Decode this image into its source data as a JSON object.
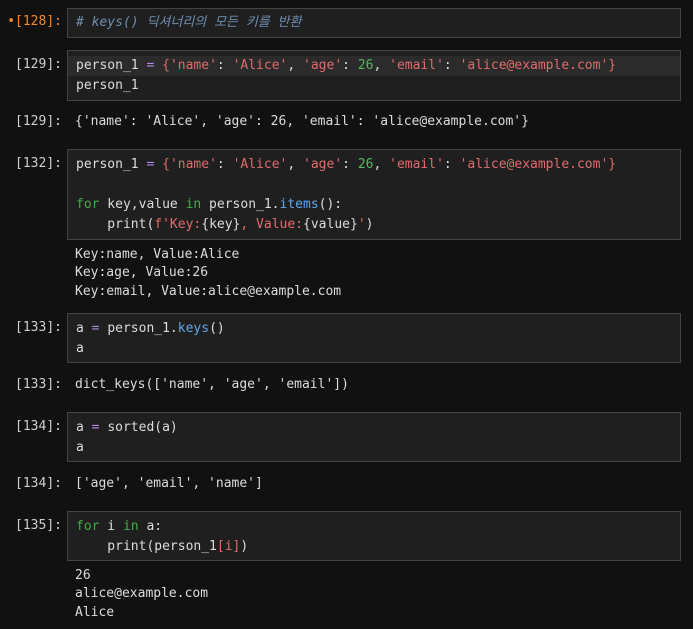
{
  "cells": [
    {
      "prompt": "•[128]:",
      "lines": [
        [
          "# keys() 딕셔너리의 모든 키를 반환"
        ]
      ]
    },
    {
      "prompt": "[129]:",
      "lines": [
        [
          "person_1",
          " = ",
          "{",
          "'name'",
          ": ",
          "'Alice'",
          ", ",
          "'age'",
          ": ",
          "26",
          ", ",
          "'email'",
          ": ",
          "'alice@example.com'",
          "}"
        ],
        [
          "person_1"
        ]
      ]
    },
    {
      "prompt": "[129]:",
      "output": [
        "{'name': 'Alice', 'age': 26, 'email': 'alice@example.com'}"
      ]
    },
    {
      "prompt": "[132]:",
      "lines": [
        [
          "person_1",
          " = ",
          "{",
          "'name'",
          ": ",
          "'Alice'",
          ", ",
          "'age'",
          ": ",
          "26",
          ", ",
          "'email'",
          ": ",
          "'alice@example.com'",
          "}"
        ],
        [
          ""
        ],
        [
          "for",
          " key,value ",
          "in",
          " person_1.",
          "items",
          "():"
        ],
        [
          "    print(",
          "f'Key:",
          "{key}",
          ", Value:",
          "{value}",
          "'",
          ")"
        ]
      ],
      "output": [
        "Key:name, Value:Alice",
        "Key:age, Value:26",
        "Key:email, Value:alice@example.com"
      ]
    },
    {
      "prompt": "[133]:",
      "lines": [
        [
          "a",
          " = ",
          "person_1.",
          "keys",
          "()"
        ],
        [
          "a"
        ]
      ]
    },
    {
      "prompt": "[133]:",
      "output": [
        "dict_keys(['name', 'age', 'email'])"
      ]
    },
    {
      "prompt": "[134]:",
      "lines": [
        [
          "a",
          " = ",
          "sorted(a)"
        ],
        [
          "a"
        ]
      ]
    },
    {
      "prompt": "[134]:",
      "output": [
        "['age', 'email', 'name']"
      ]
    },
    {
      "prompt": "[135]:",
      "lines": [
        [
          "for",
          " i ",
          "in",
          " a:"
        ],
        [
          "    print(person_1",
          "[i]",
          ")"
        ]
      ],
      "output": [
        "26",
        "alice@example.com",
        "Alice"
      ]
    }
  ]
}
